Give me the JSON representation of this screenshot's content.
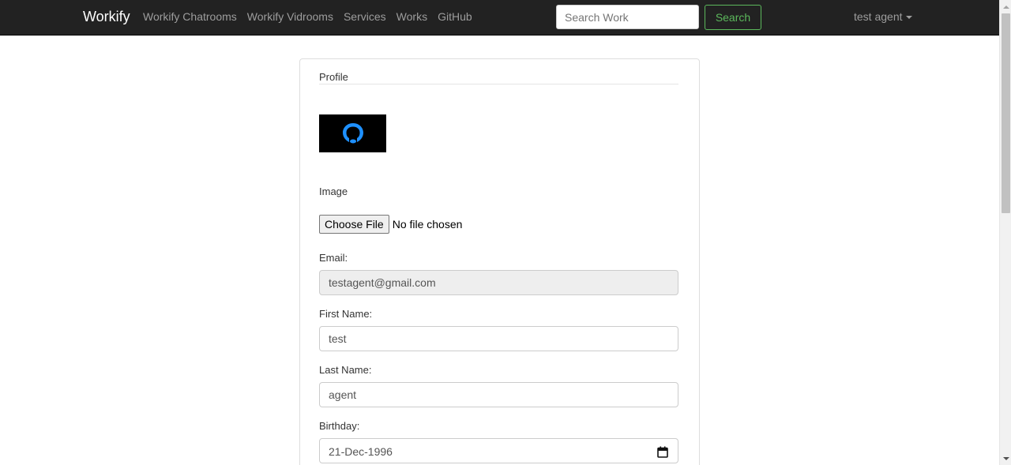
{
  "navbar": {
    "brand": "Workify",
    "links": [
      "Workify Chatrooms",
      "Workify Vidrooms",
      "Services",
      "Works",
      "GitHub"
    ],
    "search_placeholder": "Search Work",
    "search_button": "Search",
    "user_label": "test agent"
  },
  "profile": {
    "legend": "Profile",
    "image_label": "Image",
    "file_button": "Choose File",
    "file_status": "No file chosen",
    "email_label": "Email:",
    "email_value": "testagent@gmail.com",
    "first_name_label": "First Name:",
    "first_name_value": "test",
    "last_name_label": "Last Name:",
    "last_name_value": "agent",
    "birthday_label": "Birthday:",
    "birthday_value": "21-Dec-1996"
  },
  "colors": {
    "navbar_bg": "#222222",
    "search_green": "#5cb85c",
    "avatar_accent": "#1e90ff"
  }
}
